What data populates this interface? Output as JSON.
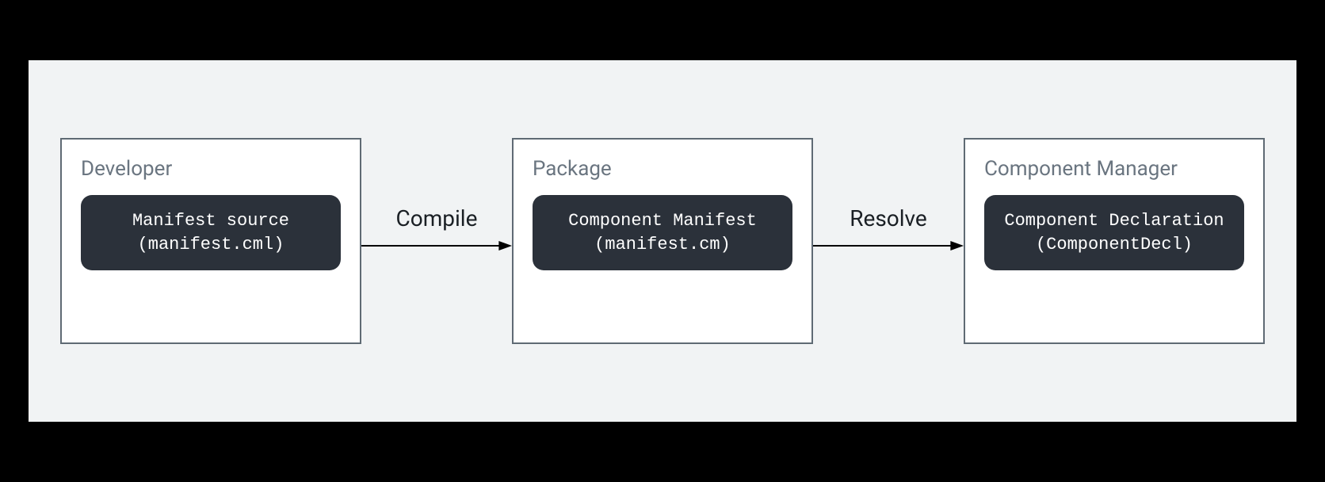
{
  "diagram": {
    "stages": [
      {
        "title": "Developer",
        "pill_line1": "Manifest source",
        "pill_line2": "(manifest.cml)"
      },
      {
        "title": "Package",
        "pill_line1": "Component Manifest",
        "pill_line2": "(manifest.cm)"
      },
      {
        "title": "Component Manager",
        "pill_line1": "Component Declaration",
        "pill_line2": "(ComponentDecl)"
      }
    ],
    "arrows": [
      {
        "label": "Compile"
      },
      {
        "label": "Resolve"
      }
    ]
  }
}
